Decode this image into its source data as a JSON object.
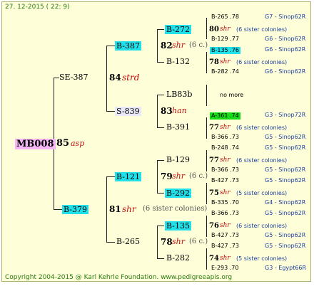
{
  "header": {
    "date": "27. 12-2015 ( 22: 9)"
  },
  "footer": {
    "copyright": "Copyright 2004-2015 @ Karl Kehrle Foundation.  www.pedigreeapis.org"
  },
  "colors": {
    "background": "#fefed8",
    "queen_box": "#f6b6f6",
    "highlight": "#22e0ea",
    "green_highlight": "#16dd16",
    "line_blue": "#1b3fa0",
    "breeder_red": "#c01010"
  },
  "root": {
    "id": "MB008",
    "year": "85",
    "breeder": "asp"
  },
  "gen1": {
    "top": {
      "id": "SE-387"
    },
    "bottom": {
      "id": "B-379"
    }
  },
  "gen2": {
    "n84": {
      "year": "84",
      "breeder": "strd"
    },
    "n81": {
      "year": "81",
      "breeder": "shr",
      "note": "(6 sister colonies)"
    },
    "b387": {
      "id": "B-387"
    },
    "s839": {
      "id": "S-839"
    },
    "b121": {
      "id": "B-121"
    },
    "b265": {
      "id": "B-265"
    }
  },
  "gen3": {
    "n82": {
      "year": "82",
      "breeder": "shr",
      "note": "(6 c.)"
    },
    "n83": {
      "year": "83",
      "breeder": "han"
    },
    "n79": {
      "year": "79",
      "breeder": "shr",
      "note": "(6 c.)"
    },
    "n78": {
      "year": "78",
      "breeder": "shr",
      "note": "(6 c.)"
    },
    "b272": {
      "id": "B-272"
    },
    "b132": {
      "id": "B-132"
    },
    "lb83b": {
      "id": "LB83b"
    },
    "b391": {
      "id": "B-391"
    },
    "b129": {
      "id": "B-129"
    },
    "b292": {
      "id": "B-292"
    },
    "b135": {
      "id": "B-135"
    },
    "b282": {
      "id": "B-282"
    }
  },
  "gen4": {
    "no_more": "no more",
    "rows": [
      {
        "a": "B-265 .78",
        "b": "G7 - Sinop62R"
      },
      {
        "a": "80",
        "b": "shr",
        "c": "(6 sister colonies)"
      },
      {
        "a": "B-129 .77",
        "b": "G6 - Sinop62R"
      },
      {
        "a": "B-135 .76",
        "b": "G6 - Sinop62R"
      },
      {
        "a": "78",
        "b": "shr",
        "c": "(6 sister colonies)"
      },
      {
        "a": "B-282 .74",
        "b": "G6 - Sinop62R"
      },
      {
        "a": "A-361 .74",
        "b": "G3 - Sinop72R"
      },
      {
        "a": "77",
        "b": "shr",
        "c": "(6 sister colonies)"
      },
      {
        "a": "B-366 .73",
        "b": "G5 - Sinop62R"
      },
      {
        "a": "B-248 .74",
        "b": "G5 - Sinop62R"
      },
      {
        "a": "77",
        "b": "shr",
        "c": "(6 sister colonies)"
      },
      {
        "a": "B-366 .73",
        "b": "G5 - Sinop62R"
      },
      {
        "a": "B-427 .73",
        "b": "G5 - Sinop62R"
      },
      {
        "a": "75",
        "b": "shr",
        "c": "(5 sister colonies)"
      },
      {
        "a": "B-335 .70",
        "b": "G4 - Sinop62R"
      },
      {
        "a": "B-366 .73",
        "b": "G5 - Sinop62R"
      },
      {
        "a": "76",
        "b": "shr",
        "c": "(6 sister colonies)"
      },
      {
        "a": "B-427 .73",
        "b": "G5 - Sinop62R"
      },
      {
        "a": "B-427 .73",
        "b": "G5 - Sinop62R"
      },
      {
        "a": "74",
        "b": "shr",
        "c": "(5 sister colonies)"
      },
      {
        "a": "E-293 .70",
        "b": "G3 - Egypt66R"
      }
    ]
  }
}
